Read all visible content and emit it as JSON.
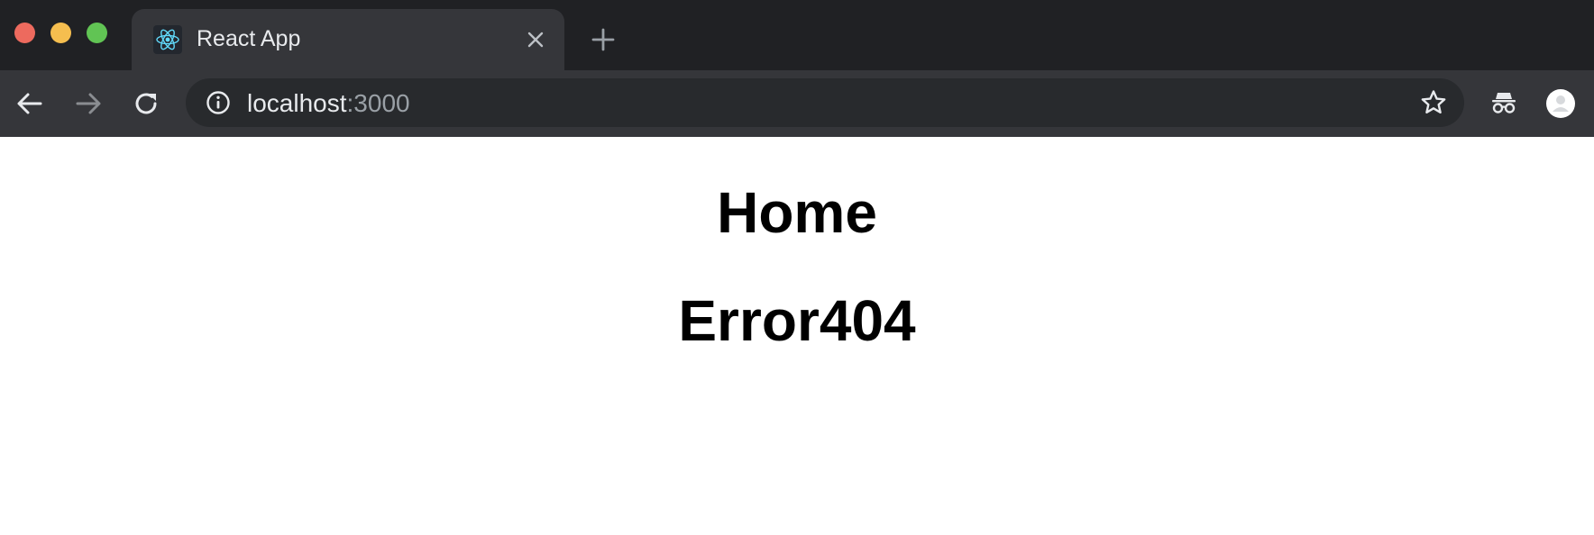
{
  "window": {
    "traffic_lights": {
      "close_color": "#ed6a5e",
      "minimize_color": "#f5be4f",
      "maximize_color": "#61c454"
    }
  },
  "tabs": [
    {
      "title": "React App",
      "favicon": "react-logo-icon",
      "active": true
    }
  ],
  "toolbar": {
    "icons": [
      "back-arrow-icon",
      "forward-arrow-icon",
      "reload-icon",
      "info-icon",
      "star-icon",
      "incognito-icon",
      "profile-avatar"
    ],
    "forward_enabled": false
  },
  "address_bar": {
    "host": "localhost",
    "port": ":3000"
  },
  "page": {
    "heading_home": "Home",
    "heading_error": "Error404"
  },
  "colors": {
    "tabstrip_bg": "#202124",
    "toolbar_bg": "#35363a",
    "omnibox_bg": "#282a2d",
    "react_accent": "#61dafb"
  }
}
